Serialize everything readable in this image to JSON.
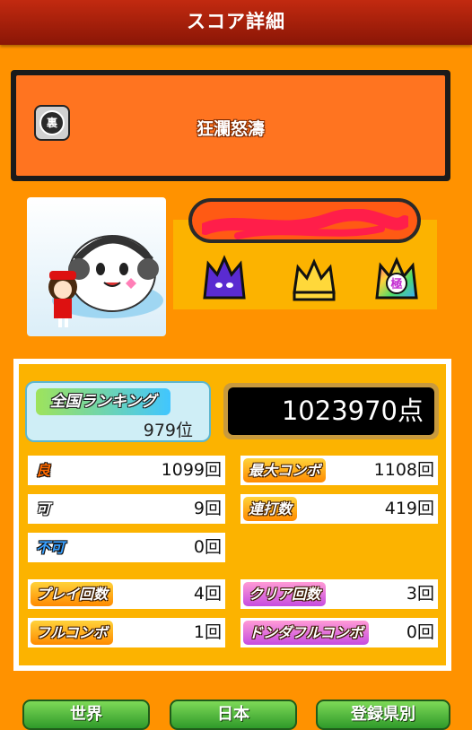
{
  "header": {
    "title": "スコア詳細"
  },
  "song": {
    "title": "狂瀾怒濤",
    "difficulty_icon_text": "裏"
  },
  "player": {
    "name_redacted": true
  },
  "badges": [
    "purple-demon-crown-icon",
    "gold-crown-icon",
    "rainbow-kiwami-icon"
  ],
  "ranking": {
    "label": "全国ランキング",
    "value": "979位"
  },
  "score": {
    "value": "1023970点"
  },
  "stats_left": [
    {
      "label": "良",
      "value": "1099回",
      "style": "plain-orange"
    },
    {
      "label": "可",
      "value": "9回",
      "style": "plain-white"
    },
    {
      "label": "不可",
      "value": "0回",
      "style": "plain-blue"
    },
    {
      "label": "プレイ回数",
      "value": "4回",
      "style": "orange"
    },
    {
      "label": "フルコンボ",
      "value": "1回",
      "style": "orange"
    }
  ],
  "stats_right": [
    {
      "label": "最大コンボ",
      "value": "1108回",
      "style": "orange"
    },
    {
      "label": "連打数",
      "value": "419回",
      "style": "orange"
    },
    {
      "label": "クリア回数",
      "value": "3回",
      "style": "pink"
    },
    {
      "label": "ドンダフルコンボ",
      "value": "0回",
      "style": "pink"
    }
  ],
  "footer_buttons": [
    "世界",
    "日本",
    "登録県別"
  ],
  "colors": {
    "background": "#ff9200",
    "header": "#b32210",
    "panel": "#fcb300"
  }
}
